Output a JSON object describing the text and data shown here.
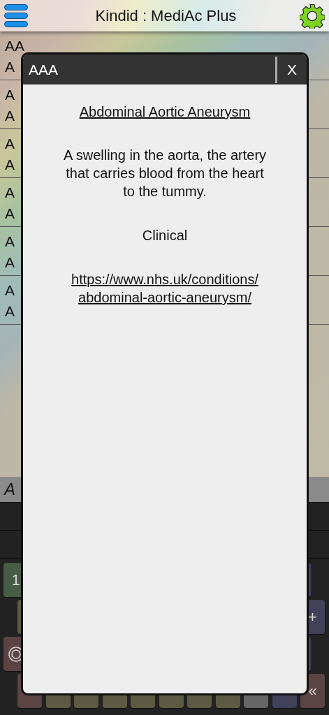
{
  "header": {
    "title": "Kindid : MediAc Plus"
  },
  "list": [
    {
      "line_1": "AA",
      "line_2": "A"
    },
    {
      "line_1": "A",
      "line_2": "A"
    },
    {
      "line_1": "A",
      "line_2": "A"
    },
    {
      "line_1": "A",
      "line_2": "A"
    },
    {
      "line_1": "A",
      "line_2": "A"
    },
    {
      "line_1": "A",
      "line_2": "A"
    }
  ],
  "search": {
    "value": "A"
  },
  "keyboard": [
    [
      {
        "kind": "number",
        "label": "1"
      },
      {
        "kind": "operator"
      }
    ],
    [
      {
        "kind": "letter"
      },
      {
        "kind": "operator",
        "label": "+"
      }
    ],
    [
      {
        "kind": "symbol"
      },
      {
        "kind": "operator"
      }
    ],
    [
      {
        "kind": "function"
      },
      {
        "kind": "letter"
      },
      {
        "kind": "letter"
      },
      {
        "kind": "letter"
      },
      {
        "kind": "letter"
      },
      {
        "kind": "letter"
      },
      {
        "kind": "letter"
      },
      {
        "kind": "letter"
      },
      {
        "kind": "space"
      },
      {
        "kind": "operator"
      },
      {
        "kind": "function",
        "label": "«"
      }
    ]
  ],
  "dialog": {
    "title": "AAA",
    "close": "X",
    "heading": "Abdominal Aortic Aneurysm",
    "description": "A swelling in the aorta, the artery that carries blood from the heart to the tummy.",
    "category": "Clinical",
    "link": "https://www.nhs.uk/conditions/abdominal-aortic-aneurysm/"
  }
}
